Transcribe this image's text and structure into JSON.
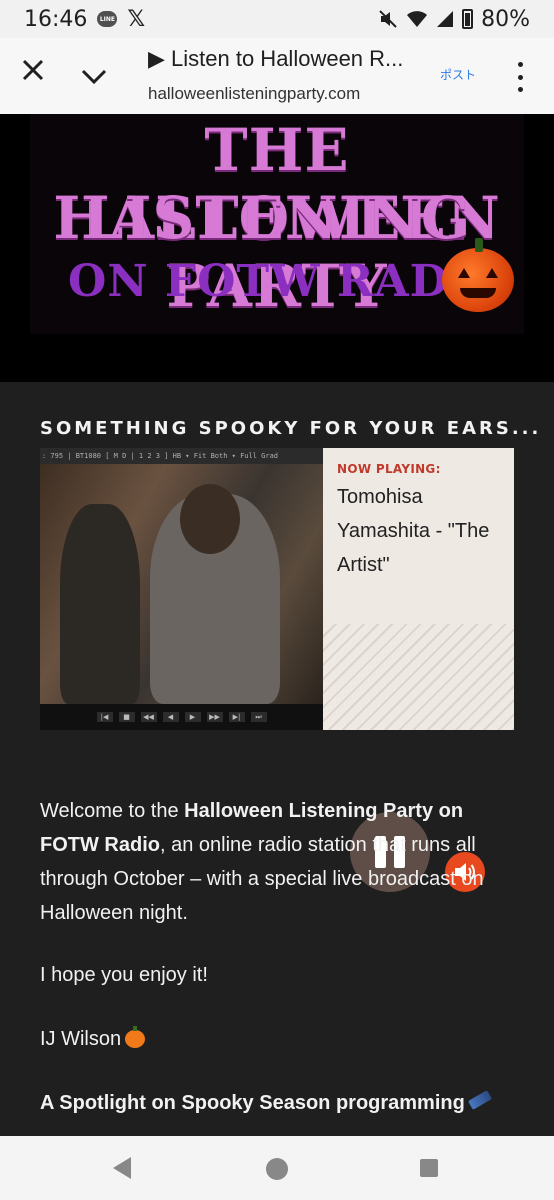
{
  "status_bar": {
    "time": "16:46",
    "line_badge": "LINE",
    "x_app": "𝕏",
    "battery": "80%"
  },
  "browser": {
    "title": "▶ Listen to Halloween R...",
    "url": "halloweenlisteningparty.com",
    "post_label": "ポスト"
  },
  "banner": {
    "line1": "THE HALLOWEEN",
    "line2": "LISTENING PARTY",
    "line3": "ON FOTW RADIO"
  },
  "section_heading": "SOMETHING SPOOKY FOR YOUR EARS...",
  "video": {
    "toolbar_text": ": 795 | BT1080 [ M D | 1 2 3 ]   HB ▾   Fit Both ▾   Full Grad"
  },
  "player": {
    "now_label": "NOW PLAYING:",
    "track": "Tomohisa Yamashita - \"The Artist\""
  },
  "content": {
    "p1_pre": "Welcome to the ",
    "p1_bold": "Halloween Listening Party on FOTW Radio",
    "p1_post": ", an online radio station that runs all through October – with a special live broadcast on Halloween night.",
    "p2": "I hope you enjoy it!",
    "p3": "IJ Wilson",
    "p4": "A Spotlight on Spooky Season programming"
  }
}
